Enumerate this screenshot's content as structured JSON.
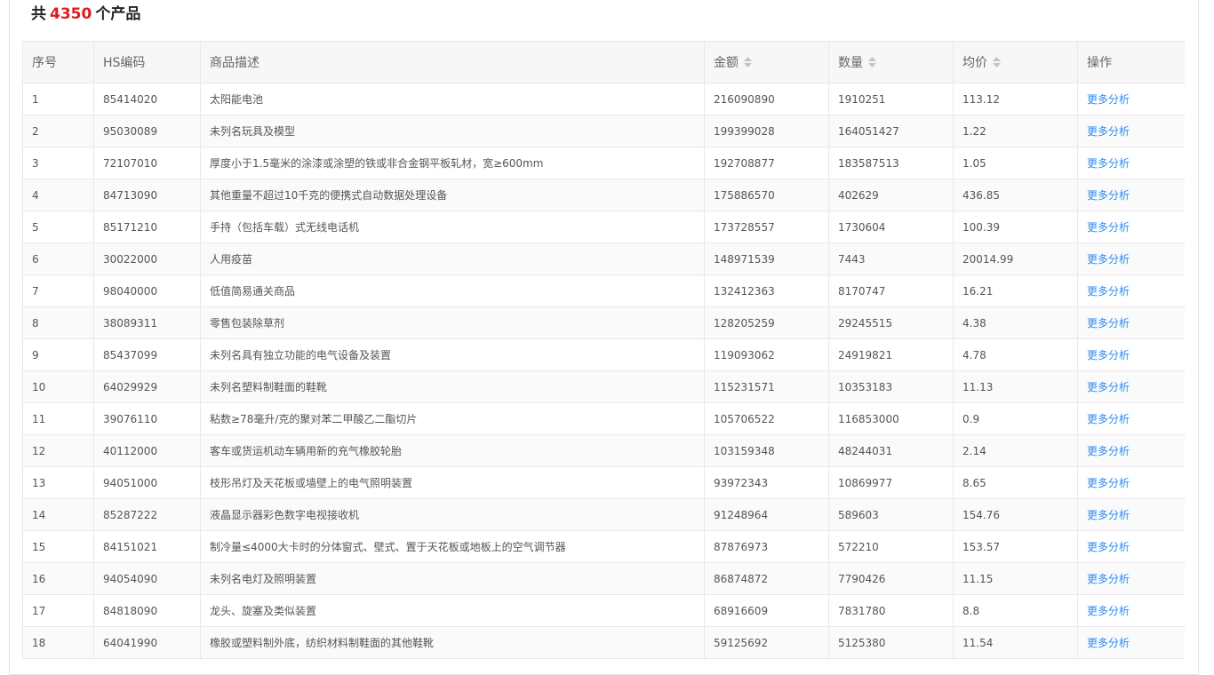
{
  "summary": {
    "prefix": "共",
    "total": "4350",
    "suffix": "个产品"
  },
  "colors": {
    "accent": "#e01b1b",
    "link": "#2d8cf0",
    "header_bg": "#f7f7f7",
    "border": "#e8e8e8"
  },
  "table": {
    "headers": {
      "index": "序号",
      "hs_code": "HS编码",
      "description": "商品描述",
      "amount": "金额",
      "quantity": "数量",
      "avg_price": "均价",
      "action": "操作"
    },
    "sortable_icon": "sort-caret-icon",
    "rows": [
      {
        "index": "1",
        "hs_code": "85414020",
        "description": "太阳能电池",
        "amount": "216090890",
        "quantity": "1910251",
        "avg_price": "113.12",
        "action": "更多分析"
      },
      {
        "index": "2",
        "hs_code": "95030089",
        "description": "未列名玩具及模型",
        "amount": "199399028",
        "quantity": "164051427",
        "avg_price": "1.22",
        "action": "更多分析"
      },
      {
        "index": "3",
        "hs_code": "72107010",
        "description": "厚度小于1.5毫米的涂漆或涂塑的铁或非合金钢平板轧材，宽≥600mm",
        "amount": "192708877",
        "quantity": "183587513",
        "avg_price": "1.05",
        "action": "更多分析"
      },
      {
        "index": "4",
        "hs_code": "84713090",
        "description": "其他重量不超过10千克的便携式自动数据处理设备",
        "amount": "175886570",
        "quantity": "402629",
        "avg_price": "436.85",
        "action": "更多分析"
      },
      {
        "index": "5",
        "hs_code": "85171210",
        "description": "手持（包括车载）式无线电话机",
        "amount": "173728557",
        "quantity": "1730604",
        "avg_price": "100.39",
        "action": "更多分析"
      },
      {
        "index": "6",
        "hs_code": "30022000",
        "description": "人用疫苗",
        "amount": "148971539",
        "quantity": "7443",
        "avg_price": "20014.99",
        "action": "更多分析"
      },
      {
        "index": "7",
        "hs_code": "98040000",
        "description": "低值简易通关商品",
        "amount": "132412363",
        "quantity": "8170747",
        "avg_price": "16.21",
        "action": "更多分析"
      },
      {
        "index": "8",
        "hs_code": "38089311",
        "description": "零售包装除草剂",
        "amount": "128205259",
        "quantity": "29245515",
        "avg_price": "4.38",
        "action": "更多分析"
      },
      {
        "index": "9",
        "hs_code": "85437099",
        "description": "未列名具有独立功能的电气设备及装置",
        "amount": "119093062",
        "quantity": "24919821",
        "avg_price": "4.78",
        "action": "更多分析"
      },
      {
        "index": "10",
        "hs_code": "64029929",
        "description": "未列名塑料制鞋面的鞋靴",
        "amount": "115231571",
        "quantity": "10353183",
        "avg_price": "11.13",
        "action": "更多分析"
      },
      {
        "index": "11",
        "hs_code": "39076110",
        "description": "粘数≥78毫升/克的聚对苯二甲酸乙二酯切片",
        "amount": "105706522",
        "quantity": "116853000",
        "avg_price": "0.9",
        "action": "更多分析"
      },
      {
        "index": "12",
        "hs_code": "40112000",
        "description": "客车或货运机动车辆用新的充气橡胶轮胎",
        "amount": "103159348",
        "quantity": "48244031",
        "avg_price": "2.14",
        "action": "更多分析"
      },
      {
        "index": "13",
        "hs_code": "94051000",
        "description": "枝形吊灯及天花板或墙壁上的电气照明装置",
        "amount": "93972343",
        "quantity": "10869977",
        "avg_price": "8.65",
        "action": "更多分析"
      },
      {
        "index": "14",
        "hs_code": "85287222",
        "description": "液晶显示器彩色数字电视接收机",
        "amount": "91248964",
        "quantity": "589603",
        "avg_price": "154.76",
        "action": "更多分析"
      },
      {
        "index": "15",
        "hs_code": "84151021",
        "description": "制冷量≤4000大卡时的分体窗式、壁式、置于天花板或地板上的空气调节器",
        "amount": "87876973",
        "quantity": "572210",
        "avg_price": "153.57",
        "action": "更多分析"
      },
      {
        "index": "16",
        "hs_code": "94054090",
        "description": "未列名电灯及照明装置",
        "amount": "86874872",
        "quantity": "7790426",
        "avg_price": "11.15",
        "action": "更多分析"
      },
      {
        "index": "17",
        "hs_code": "84818090",
        "description": "龙头、旋塞及类似装置",
        "amount": "68916609",
        "quantity": "7831780",
        "avg_price": "8.8",
        "action": "更多分析"
      },
      {
        "index": "18",
        "hs_code": "64041990",
        "description": "橡胶或塑料制外底，纺织材料制鞋面的其他鞋靴",
        "amount": "59125692",
        "quantity": "5125380",
        "avg_price": "11.54",
        "action": "更多分析"
      }
    ]
  }
}
